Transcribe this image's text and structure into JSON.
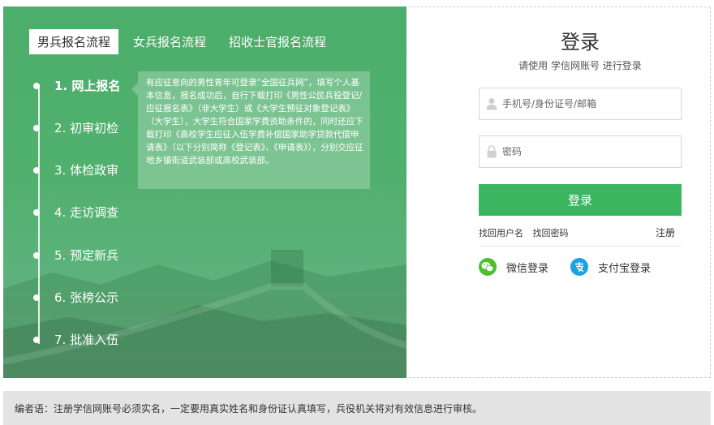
{
  "tabs": [
    {
      "label": "男兵报名流程",
      "active": true
    },
    {
      "label": "女兵报名流程",
      "active": false
    },
    {
      "label": "招收士官报名流程",
      "active": false
    }
  ],
  "steps": [
    {
      "label": "1. 网上报名"
    },
    {
      "label": "2. 初审初检"
    },
    {
      "label": "3. 体检政审"
    },
    {
      "label": "4. 走访调查"
    },
    {
      "label": "5. 预定新兵"
    },
    {
      "label": "6. 张榜公示"
    },
    {
      "label": "7. 批准入伍"
    }
  ],
  "tip_text": "有应征意向的男性青年可登录“全国征兵网”，填写个人基本信息，报名成功后，自行下载打印《男性公民兵役登记/应征报名表》（非大学生）或《大学生预征对象登记表》（大学生），大学生符合国家学费资助条件的，同时还应下载打印《高校学生应征入伍学费补偿国家助学贷款代偿申请表》（以下分别简称《登记表》、《申请表》），分别交应征 地乡镇街道武装部或高校武装部。",
  "login": {
    "title": "登录",
    "subtitle": "请使用 学信网账号 进行登录",
    "username_placeholder": "手机号/身份证号/邮箱",
    "password_placeholder": "密码",
    "submit_label": "登录",
    "find_user": "找回用户名",
    "find_password": "找回密码",
    "register": "注册",
    "wechat": "微信登录",
    "alipay": "支付宝登录"
  },
  "note": "编者语：注册学信网账号必须实名，一定要用真实姓名和身份证认真填写，兵役机关将对有效信息进行审核。",
  "colors": {
    "panel_green": "#4cae6a",
    "button_green": "#3cb561",
    "wechat_green": "#4cbf2e",
    "alipay_blue": "#1aa1e6"
  }
}
